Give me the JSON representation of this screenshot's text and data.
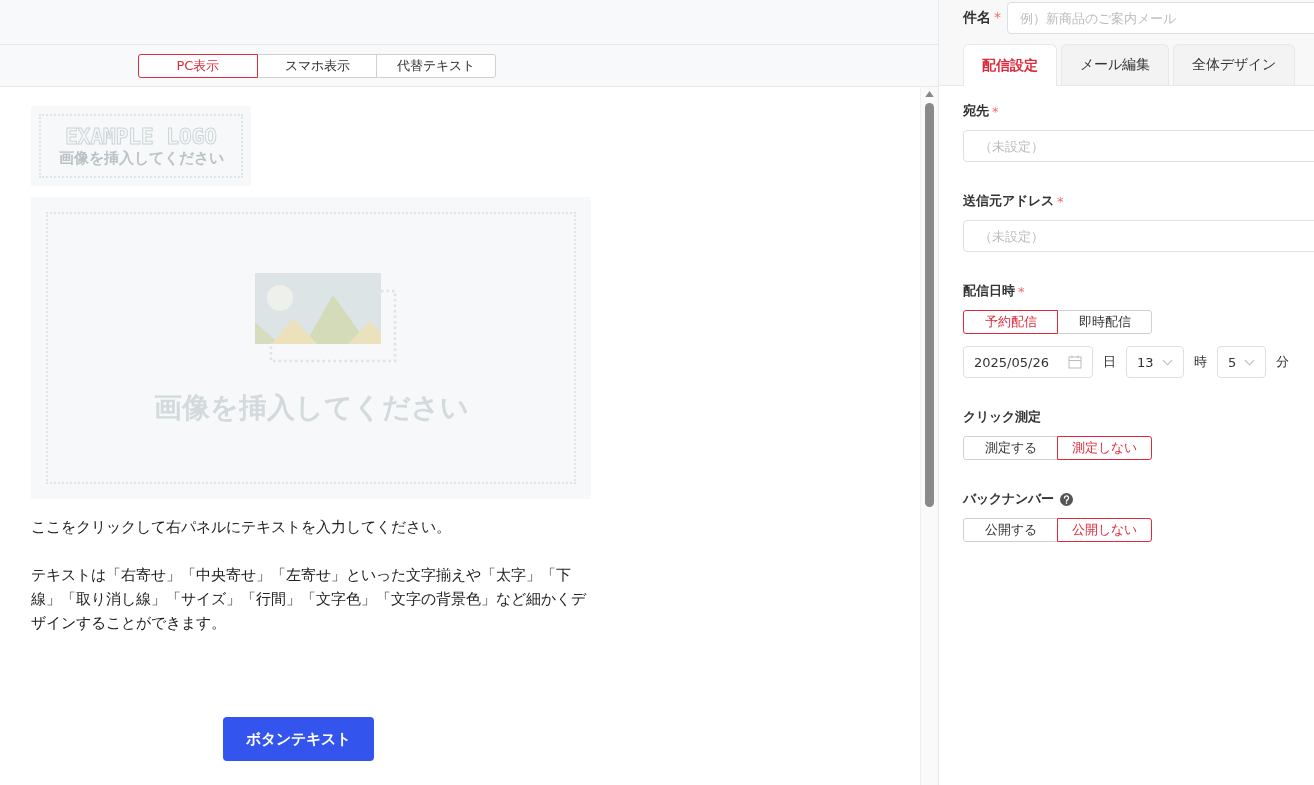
{
  "preview": {
    "view_tabs": [
      {
        "label": "PC表示",
        "selected": true
      },
      {
        "label": "スマホ表示",
        "selected": false
      },
      {
        "label": "代替テキスト",
        "selected": false
      }
    ],
    "logo_placeholder": {
      "logo_text": "EXAMPLE LOGO",
      "hint": "画像を挿入してください"
    },
    "image_placeholder": {
      "hint": "画像を挿入してください"
    },
    "paragraphs": [
      "ここをクリックして右パネルにテキストを入力してください。",
      "テキストは「右寄せ」「中央寄せ」「左寄せ」といった文字揃えや「太字」「下線」「取り消し線」「サイズ」「行間」「文字色」「文字の背景色」など細かくデザインすることができます。"
    ],
    "button": "ボタンテキスト"
  },
  "settings": {
    "subject": {
      "label": "件名",
      "required_mark": "*",
      "placeholder": "例）新商品のご案内メール"
    },
    "tabs": [
      {
        "label": "配信設定",
        "selected": true
      },
      {
        "label": "メール編集",
        "selected": false
      },
      {
        "label": "全体デザイン",
        "selected": false
      }
    ],
    "fields": [
      {
        "kind": "input",
        "label": "宛先",
        "required_mark": "*",
        "placeholder": "（未設定）"
      },
      {
        "kind": "input",
        "label": "送信元アドレス",
        "required_mark": "*",
        "placeholder": "（未設定）"
      },
      {
        "kind": "datetime",
        "label": "配信日時",
        "required_mark": "*",
        "options": [
          {
            "label": "予約配信",
            "selected": true
          },
          {
            "label": "即時配信",
            "selected": false
          }
        ],
        "date": "2025/05/26",
        "date_unit": "日",
        "hour": "13",
        "hour_unit": "時",
        "minute": "5",
        "minute_unit": "分"
      },
      {
        "kind": "segmented",
        "label": "クリック測定",
        "options": [
          {
            "label": "測定する",
            "selected": false
          },
          {
            "label": "測定しない",
            "selected": true
          }
        ]
      },
      {
        "kind": "segmented",
        "label": "バックナンバー",
        "help": true,
        "options": [
          {
            "label": "公開する",
            "selected": false
          },
          {
            "label": "公開しない",
            "selected": true
          }
        ]
      }
    ]
  }
}
